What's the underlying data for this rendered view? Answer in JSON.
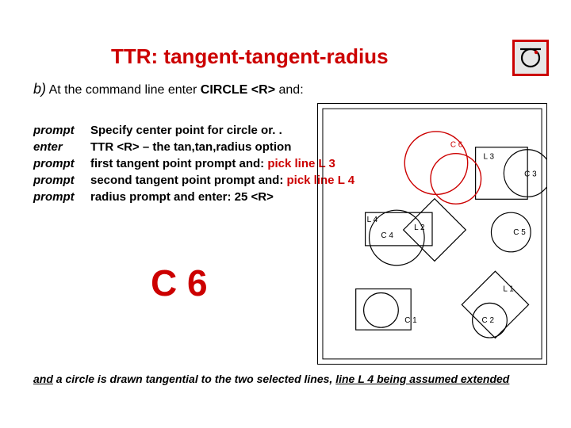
{
  "title": "TTR: tangent-tangent-radius",
  "icon": "circle-tangent-icon",
  "sub": {
    "b": "b)",
    "at": " At the command line enter ",
    "cmd": "CIRCLE <R>",
    "and": " and:"
  },
  "rows": [
    {
      "lbl": "prompt",
      "txt": "Specify center point for circle or. ."
    },
    {
      "lbl": "enter",
      "txt": "TTR <R> – the tan,tan,radius option"
    },
    {
      "lbl": "prompt",
      "txt": "first tangent point prompt and: ",
      "pick": "pick line L 3"
    },
    {
      "lbl": "prompt",
      "txt": "second tangent point prompt and: ",
      "pick": "pick line L 4"
    },
    {
      "lbl": "prompt",
      "txt": "radius prompt and enter: 25 <R>"
    }
  ],
  "c6": "C 6",
  "foot": {
    "and": "and",
    "mid": " a circle is drawn tangential to the two selected lines, ",
    "line": "line L 4 being assumed extended"
  },
  "labels": {
    "c6": "C 6",
    "l3": "L 3",
    "c3": "C 3",
    "l4": "L 4",
    "c4": "C 4",
    "l2": "L 2",
    "c5": "C 5",
    "c1": "C 1",
    "l1": "L 1",
    "c2": "C 2"
  }
}
